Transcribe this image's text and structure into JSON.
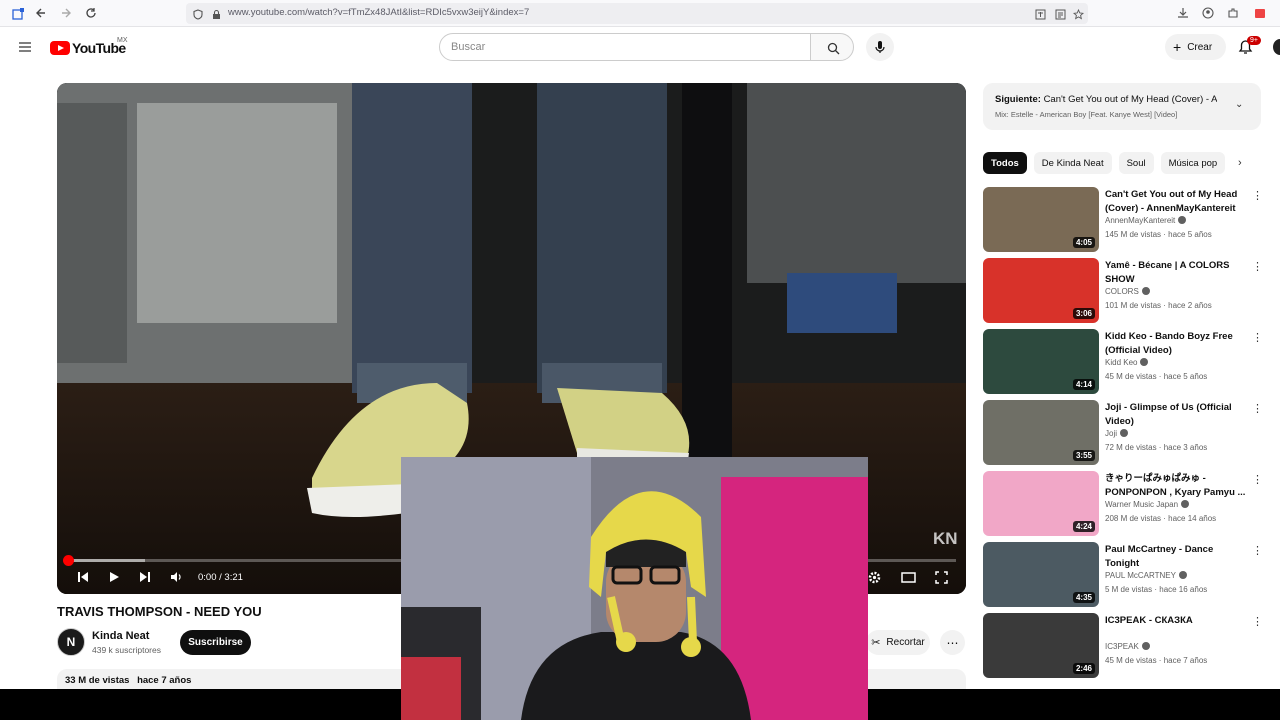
{
  "browser": {
    "url": "www.youtube.com/watch?v=fTmZx48JAtI&list=RDIc5vxw3eijY&index=7"
  },
  "header": {
    "logo_text": "YouTube",
    "region": "MX",
    "search_placeholder": "Buscar",
    "create_label": "Crear",
    "notifications_badge": "9+"
  },
  "player": {
    "time": "0:00 / 3:21",
    "progress_fraction": 0.0,
    "watermark": "KN"
  },
  "video": {
    "title": "TRAVIS THOMPSON - NEED YOU",
    "channel_initials": "N",
    "channel_name": "Kinda Neat",
    "subscribers": "439 k suscriptores",
    "subscribe_label": "Suscribirse",
    "clip_label": "Recortar",
    "views": "33 M de vistas",
    "age": "hace 7 años"
  },
  "sidebar": {
    "next_prefix": "Siguiente:",
    "next_title": "Can't Get You out of My Head (Cover) - A...",
    "next_mix": "Mix: Estelle - American Boy [Feat. Kanye West] [Video]",
    "chips": [
      "Todos",
      "De Kinda Neat",
      "Soul",
      "Música pop"
    ],
    "recommendations": [
      {
        "title": "Can't Get You out of My Head (Cover) - AnnenMayKantereit x...",
        "channel": "AnnenMayKantereit",
        "meta": "145 M de vistas · hace 5 años",
        "duration": "4:05",
        "thumb_color": "#7a6a55"
      },
      {
        "title": "Yamê - Bécane | A COLORS SHOW",
        "channel": "COLORS",
        "meta": "101 M de vistas · hace 2 años",
        "duration": "3:06",
        "thumb_color": "#d8322a"
      },
      {
        "title": "Kidd Keo - Bando Boyz Free (Official Video)",
        "channel": "Kidd Keo",
        "meta": "45 M de vistas · hace 5 años",
        "duration": "4:14",
        "thumb_color": "#2d4a3e"
      },
      {
        "title": "Joji - Glimpse of Us (Official Video)",
        "channel": "Joji",
        "meta": "72 M de vistas · hace 3 años",
        "duration": "3:55",
        "thumb_color": "#6f6f66"
      },
      {
        "title": "きゃりーぱみゅぱみゅ - PONPONPON , Kyary Pamyu ...",
        "channel": "Warner Music Japan",
        "meta": "208 M de vistas · hace 14 años",
        "duration": "4:24",
        "thumb_color": "#f1a7c7"
      },
      {
        "title": "Paul McCartney - Dance Tonight",
        "channel": "PAUL McCARTNEY",
        "meta": "5 M de vistas · hace 16 años",
        "duration": "4:35",
        "thumb_color": "#4c5a62"
      },
      {
        "title": "IC3PEAK - СКАЗКА",
        "channel": "IC3PEAK",
        "meta": "45 M de vistas · hace 7 años",
        "duration": "2:46",
        "thumb_color": "#3a3a3a"
      }
    ]
  }
}
